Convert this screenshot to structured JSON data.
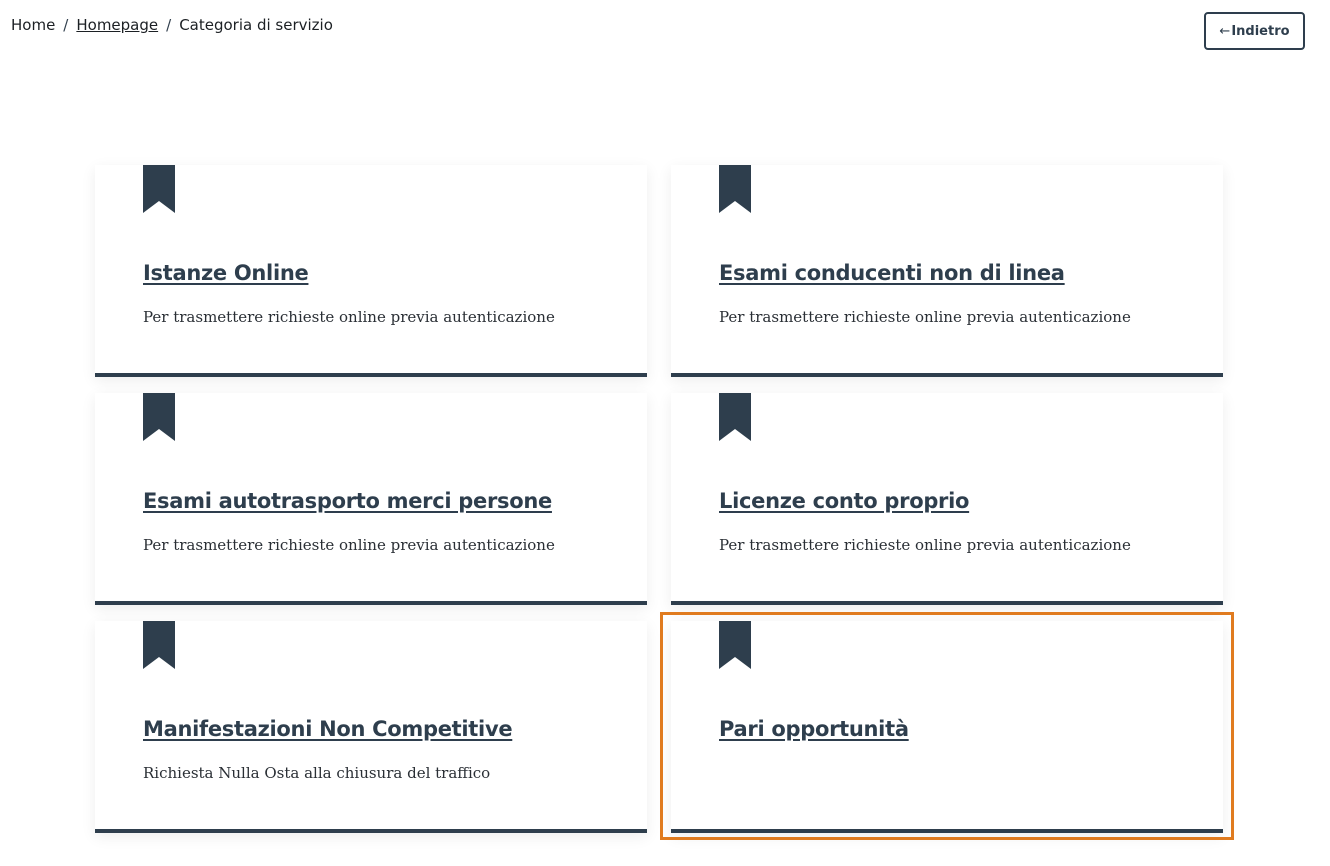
{
  "breadcrumb": {
    "home": "Home",
    "separator": "/",
    "homepage": "Homepage",
    "current": "Categoria di servizio"
  },
  "back_button": {
    "arrow": "←",
    "label": "Indietro"
  },
  "cards": [
    {
      "title": "Istanze Online",
      "description": "Per trasmettere richieste online previa autenticazione"
    },
    {
      "title": "Esami conducenti non di linea",
      "description": "Per trasmettere richieste online previa autenticazione"
    },
    {
      "title": "Esami autotrasporto merci persone",
      "description": "Per trasmettere richieste online previa autenticazione"
    },
    {
      "title": "Licenze conto proprio",
      "description": "Per trasmettere richieste online previa autenticazione"
    },
    {
      "title": "Manifestazioni Non Competitive",
      "description": "Richiesta Nulla Osta alla chiusura del traffico"
    },
    {
      "title": "Pari opportunità",
      "description": ""
    }
  ],
  "colors": {
    "primary": "#2e3e4d",
    "highlight": "#e07b1f"
  },
  "icons": {
    "card_icon": "bookmark-icon"
  }
}
